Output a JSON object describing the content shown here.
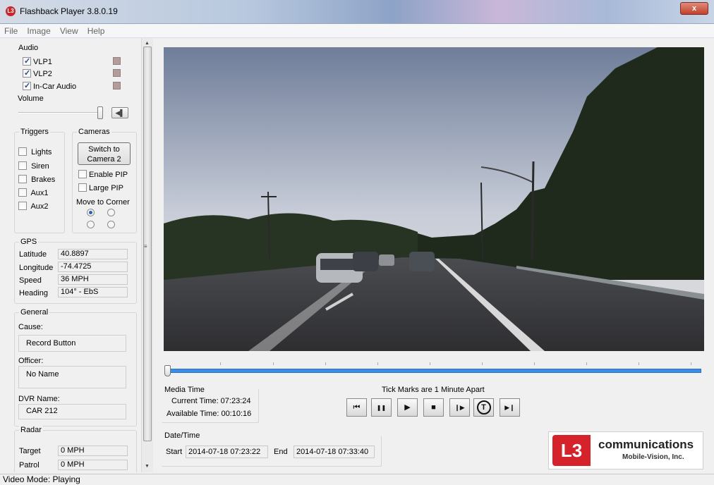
{
  "window": {
    "title": "Flashback Player 3.8.0.19",
    "close_label": "x"
  },
  "menu": [
    "File",
    "Image",
    "View",
    "Help"
  ],
  "audio": {
    "title": "Audio",
    "channels": [
      {
        "label": "VLP1",
        "checked": true
      },
      {
        "label": "VLP2",
        "checked": true
      },
      {
        "label": "In-Car Audio",
        "checked": true
      }
    ],
    "volume_label": "Volume"
  },
  "triggers": {
    "title": "Triggers",
    "items": [
      "Lights",
      "Siren",
      "Brakes",
      "Aux1",
      "Aux2"
    ]
  },
  "cameras": {
    "title": "Cameras",
    "switch_button": "Switch to Camera 2",
    "enable_pip": "Enable PIP",
    "large_pip": "Large PIP",
    "move_to_corner": "Move to Corner"
  },
  "gps": {
    "title": "GPS",
    "latitude_label": "Latitude",
    "latitude": "40.8897",
    "longitude_label": "Longitude",
    "longitude": "-74.4725",
    "speed_label": "Speed",
    "speed": "36 MPH",
    "heading_label": "Heading",
    "heading": "104° - EbS"
  },
  "general": {
    "title": "General",
    "cause_label": "Cause:",
    "cause": "Record Button",
    "officer_label": "Officer:",
    "officer": "No Name",
    "dvr_label": "DVR Name:",
    "dvr": "CAR 212"
  },
  "radar": {
    "title": "Radar",
    "target_label": "Target",
    "target": "0 MPH",
    "patrol_label": "Patrol",
    "patrol": "0 MPH"
  },
  "media_time": {
    "title": "Media Time",
    "current": "Current Time: 07:23:24",
    "available": "Available Time: 00:10:16"
  },
  "tick_note": "Tick Marks are 1 Minute Apart",
  "controls": {
    "skip_start": "⏮",
    "pause": "❚❚",
    "play": "▶",
    "stop": "■",
    "step": "❙▶",
    "tag": "T",
    "skip_end": "▶❙"
  },
  "date_time": {
    "title": "Date/Time",
    "start_label": "Start",
    "start": "2014-07-18 07:23:22",
    "end_label": "End",
    "end": "2014-07-18 07:33:40"
  },
  "logo": {
    "mark": "L3",
    "name": "communications",
    "sub": "Mobile-Vision, Inc."
  },
  "status": "Video Mode: Playing"
}
